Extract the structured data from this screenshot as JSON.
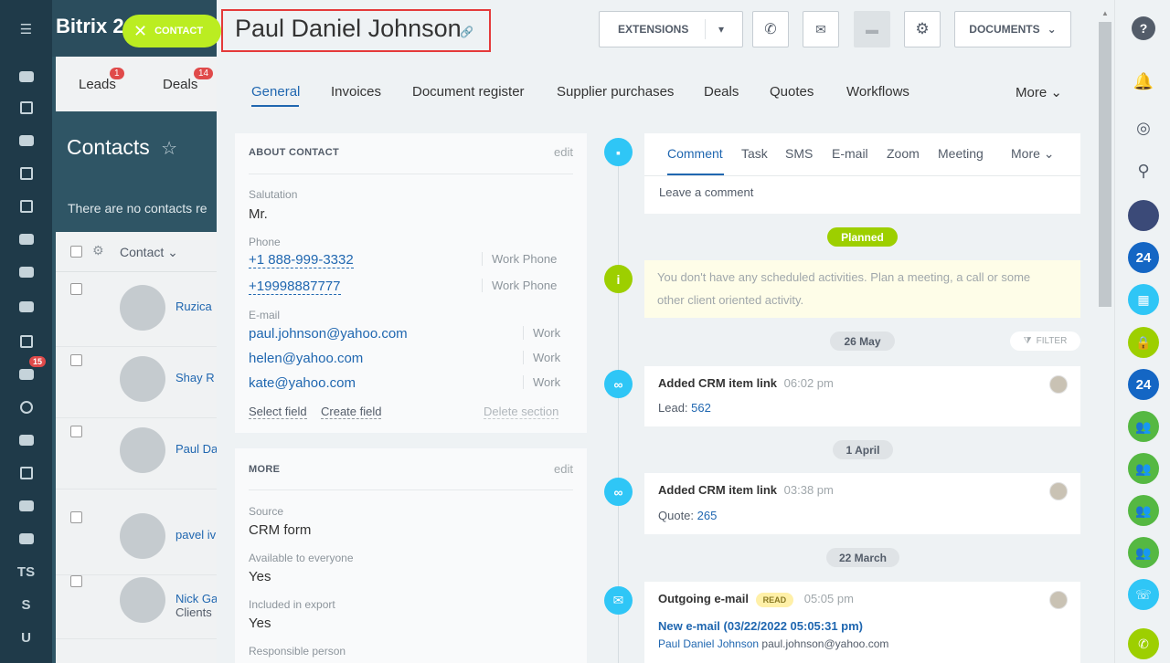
{
  "app": {
    "title": "Bitrix 24"
  },
  "contact_button": {
    "label": "CONTACT",
    "close_icon": "close-icon"
  },
  "background": {
    "tabs": [
      {
        "label": "Leads",
        "badge": "1"
      },
      {
        "label": "Deals",
        "badge": "14"
      }
    ],
    "page_title": "Contacts",
    "empty_text": "There are no contacts re",
    "column_header": "Contact",
    "rows": [
      {
        "name": "Ruzica"
      },
      {
        "name": "Shay R"
      },
      {
        "name": "Paul Da"
      },
      {
        "name": "pavel iv"
      },
      {
        "name": "Nick Ga",
        "sub": "Clients"
      }
    ],
    "sidebar_badge": "15",
    "sidebar_labels": [
      "TS",
      "S",
      "U"
    ]
  },
  "contact": {
    "name": "Paul Daniel  Johnson",
    "link_icon": "link-icon"
  },
  "toolbar": {
    "extensions_label": "EXTENSIONS",
    "documents_label": "DOCUMENTS"
  },
  "tabs": [
    "General",
    "Invoices",
    "Document register",
    "Supplier purchases",
    "Deals",
    "Quotes",
    "Workflows"
  ],
  "tabs_more": "More",
  "about": {
    "title": "ABOUT CONTACT",
    "edit": "edit",
    "salutation_label": "Salutation",
    "salutation": "Mr.",
    "phone_label": "Phone",
    "phones": [
      {
        "value": "+1 888-999-3332",
        "type": "Work Phone"
      },
      {
        "value": "+19998887777",
        "type": "Work Phone"
      }
    ],
    "email_label": "E-mail",
    "emails": [
      {
        "value": "paul.johnson@yahoo.com",
        "type": "Work"
      },
      {
        "value": "helen@yahoo.com",
        "type": "Work"
      },
      {
        "value": "kate@yahoo.com",
        "type": "Work"
      }
    ],
    "select_field": "Select field",
    "create_field": "Create field",
    "delete_section": "Delete section"
  },
  "more_section": {
    "title": "MORE",
    "edit": "edit",
    "source_label": "Source",
    "source": "CRM form",
    "available_label": "Available to everyone",
    "available": "Yes",
    "export_label": "Included in export",
    "export": "Yes",
    "responsible_label": "Responsible person"
  },
  "editor": {
    "tabs": [
      "Comment",
      "Task",
      "SMS",
      "E-mail",
      "Zoom",
      "Meeting"
    ],
    "more": "More",
    "placeholder": "Leave a comment"
  },
  "timeline": {
    "planned_label": "Planned",
    "planned_text_1": "You don't have any scheduled activities. Plan a meeting, a call or some",
    "planned_text_2": "other client oriented activity.",
    "filter_label": "FILTER",
    "groups": [
      {
        "date": "26 May",
        "title": "Added CRM item link",
        "time": "06:02 pm",
        "body_prefix": "Lead:",
        "body_link": "562"
      },
      {
        "date": "1 April",
        "title": "Added CRM item link",
        "time": "03:38 pm",
        "body_prefix": "Quote:",
        "body_link": "265"
      },
      {
        "date": "22 March",
        "title": "Outgoing e-mail",
        "read": "READ",
        "time": "05:05 pm",
        "subject": "New e-mail (03/22/2022 05:05:31 pm)",
        "from_name": "Paul Daniel Johnson",
        "from_email": "paul.johnson@yahoo.com"
      }
    ]
  },
  "right_bar": {
    "badge_24": "24"
  }
}
